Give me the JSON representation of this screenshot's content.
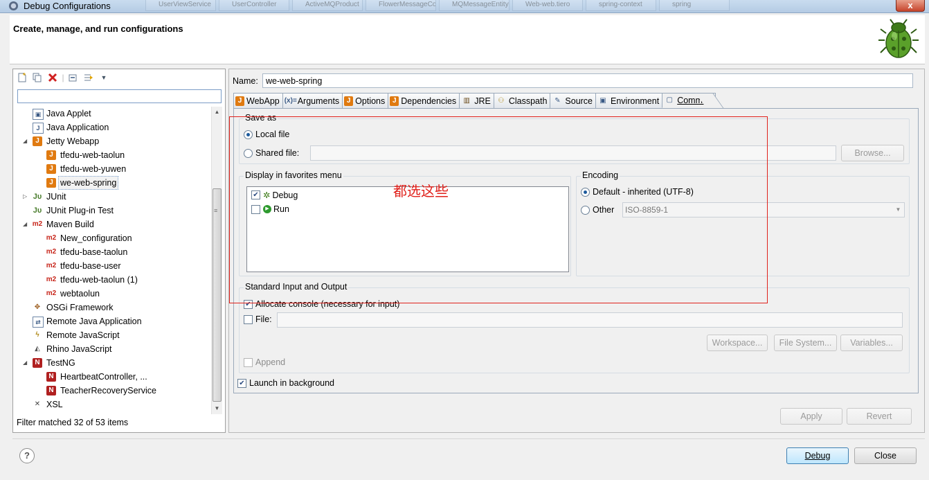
{
  "window": {
    "title": "Debug Configurations",
    "background_tabs": [
      "UserViewService",
      "UserController",
      "ActiveMQProduct",
      "FlowerMessageCo",
      "MQMessageEntity",
      "Web-web.tiero",
      "spring-context",
      "spring"
    ],
    "close_label": "x"
  },
  "header": {
    "heading": "Create, manage, and run configurations"
  },
  "left": {
    "filter_text": "",
    "tree": [
      {
        "label": "Java Applet",
        "icon": "java-applet-icon"
      },
      {
        "label": "Java Application",
        "icon": "java-application-icon"
      },
      {
        "label": "Jetty Webapp",
        "icon": "jetty-icon",
        "expanded": true
      },
      {
        "label": "tfedu-web-taolun",
        "icon": "jetty-icon"
      },
      {
        "label": "tfedu-web-yuwen",
        "icon": "jetty-icon"
      },
      {
        "label": "we-web-spring",
        "icon": "jetty-icon",
        "selected": true
      },
      {
        "label": "JUnit",
        "icon": "junit-icon",
        "expanded": false
      },
      {
        "label": "JUnit Plug-in Test",
        "icon": "junit-plugin-icon"
      },
      {
        "label": "Maven Build",
        "icon": "maven-icon",
        "expanded": true
      },
      {
        "label": "New_configuration",
        "icon": "maven-icon"
      },
      {
        "label": "tfedu-base-taolun",
        "icon": "maven-icon"
      },
      {
        "label": "tfedu-base-user",
        "icon": "maven-icon"
      },
      {
        "label": "tfedu-web-taolun (1)",
        "icon": "maven-icon"
      },
      {
        "label": "webtaolun",
        "icon": "maven-icon"
      },
      {
        "label": "OSGi Framework",
        "icon": "osgi-icon"
      },
      {
        "label": "Remote Java Application",
        "icon": "remote-java-icon"
      },
      {
        "label": "Remote JavaScript",
        "icon": "remote-javascript-icon"
      },
      {
        "label": "Rhino JavaScript",
        "icon": "rhino-icon"
      },
      {
        "label": "TestNG",
        "icon": "testng-icon",
        "expanded": true
      },
      {
        "label": "HeartbeatController, ...",
        "icon": "testng-icon"
      },
      {
        "label": "TeacherRecoveryService",
        "icon": "testng-icon"
      },
      {
        "label": "XSL",
        "icon": "xsl-icon"
      }
    ],
    "filter_status": "Filter matched 32 of 53 items"
  },
  "right": {
    "name_label": "Name:",
    "name_value": "we-web-spring",
    "tabs": [
      "WebApp",
      "Arguments",
      "Options",
      "Dependencies",
      "JRE",
      "Classpath",
      "Source",
      "Environment",
      "Common"
    ],
    "save_as": {
      "title": "Save as",
      "local_file": "Local file",
      "shared_file": "Shared file:",
      "browse": "Browse..."
    },
    "favorites": {
      "title": "Display in favorites menu",
      "debug": "Debug",
      "run": "Run"
    },
    "encoding": {
      "title": "Encoding",
      "default": "Default - inherited (UTF-8)",
      "other": "Other",
      "other_value": "ISO-8859-1"
    },
    "std_io": {
      "title": "Standard Input and Output",
      "allocate": "Allocate console (necessary for input)",
      "file": "File:",
      "workspace": "Workspace...",
      "file_system": "File System...",
      "variables": "Variables...",
      "append": "Append"
    },
    "launch_bg": "Launch in background",
    "apply": "Apply",
    "revert": "Revert"
  },
  "annotation": "都选这些",
  "footer": {
    "help": "?",
    "debug": "Debug",
    "close": "Close"
  }
}
